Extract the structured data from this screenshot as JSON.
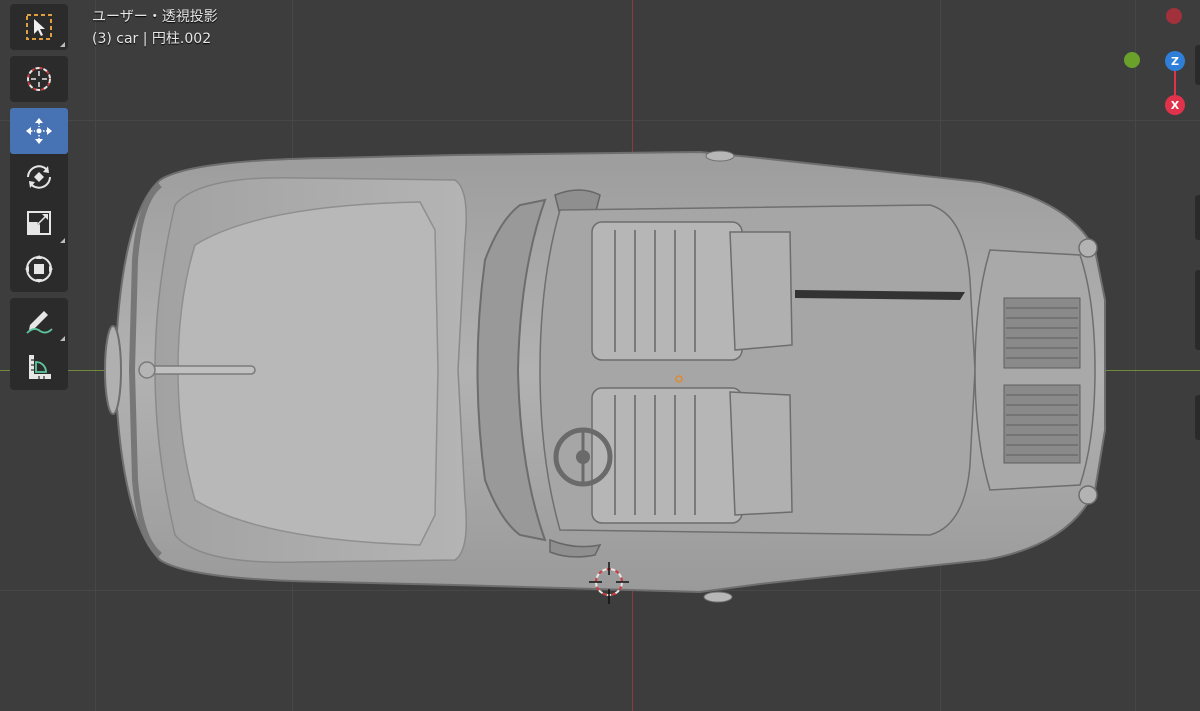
{
  "viewport": {
    "mode_label": "ユーザー・透視投影",
    "object_label": "(3) car | 円柱.002"
  },
  "toolbar": {
    "tools": [
      {
        "name": "select-box",
        "active": false
      },
      {
        "name": "cursor",
        "active": false
      },
      {
        "name": "move",
        "active": true
      },
      {
        "name": "rotate",
        "active": false
      },
      {
        "name": "scale",
        "active": false
      },
      {
        "name": "transform",
        "active": false
      },
      {
        "name": "annotate",
        "active": false
      },
      {
        "name": "measure",
        "active": false
      }
    ]
  },
  "gizmo": {
    "z_label": "Z",
    "x_label": "X",
    "colors": {
      "z": "#2f7fd8",
      "x": "#e0334b",
      "y": "#6aa12b",
      "x_neg": "#a1323c"
    }
  },
  "colors": {
    "background": "#3d3d3d",
    "active_tool": "#4772b3",
    "x_axis": "#8a3c3c",
    "y_axis": "#6e8a3a",
    "model": "#a8a8a8"
  }
}
